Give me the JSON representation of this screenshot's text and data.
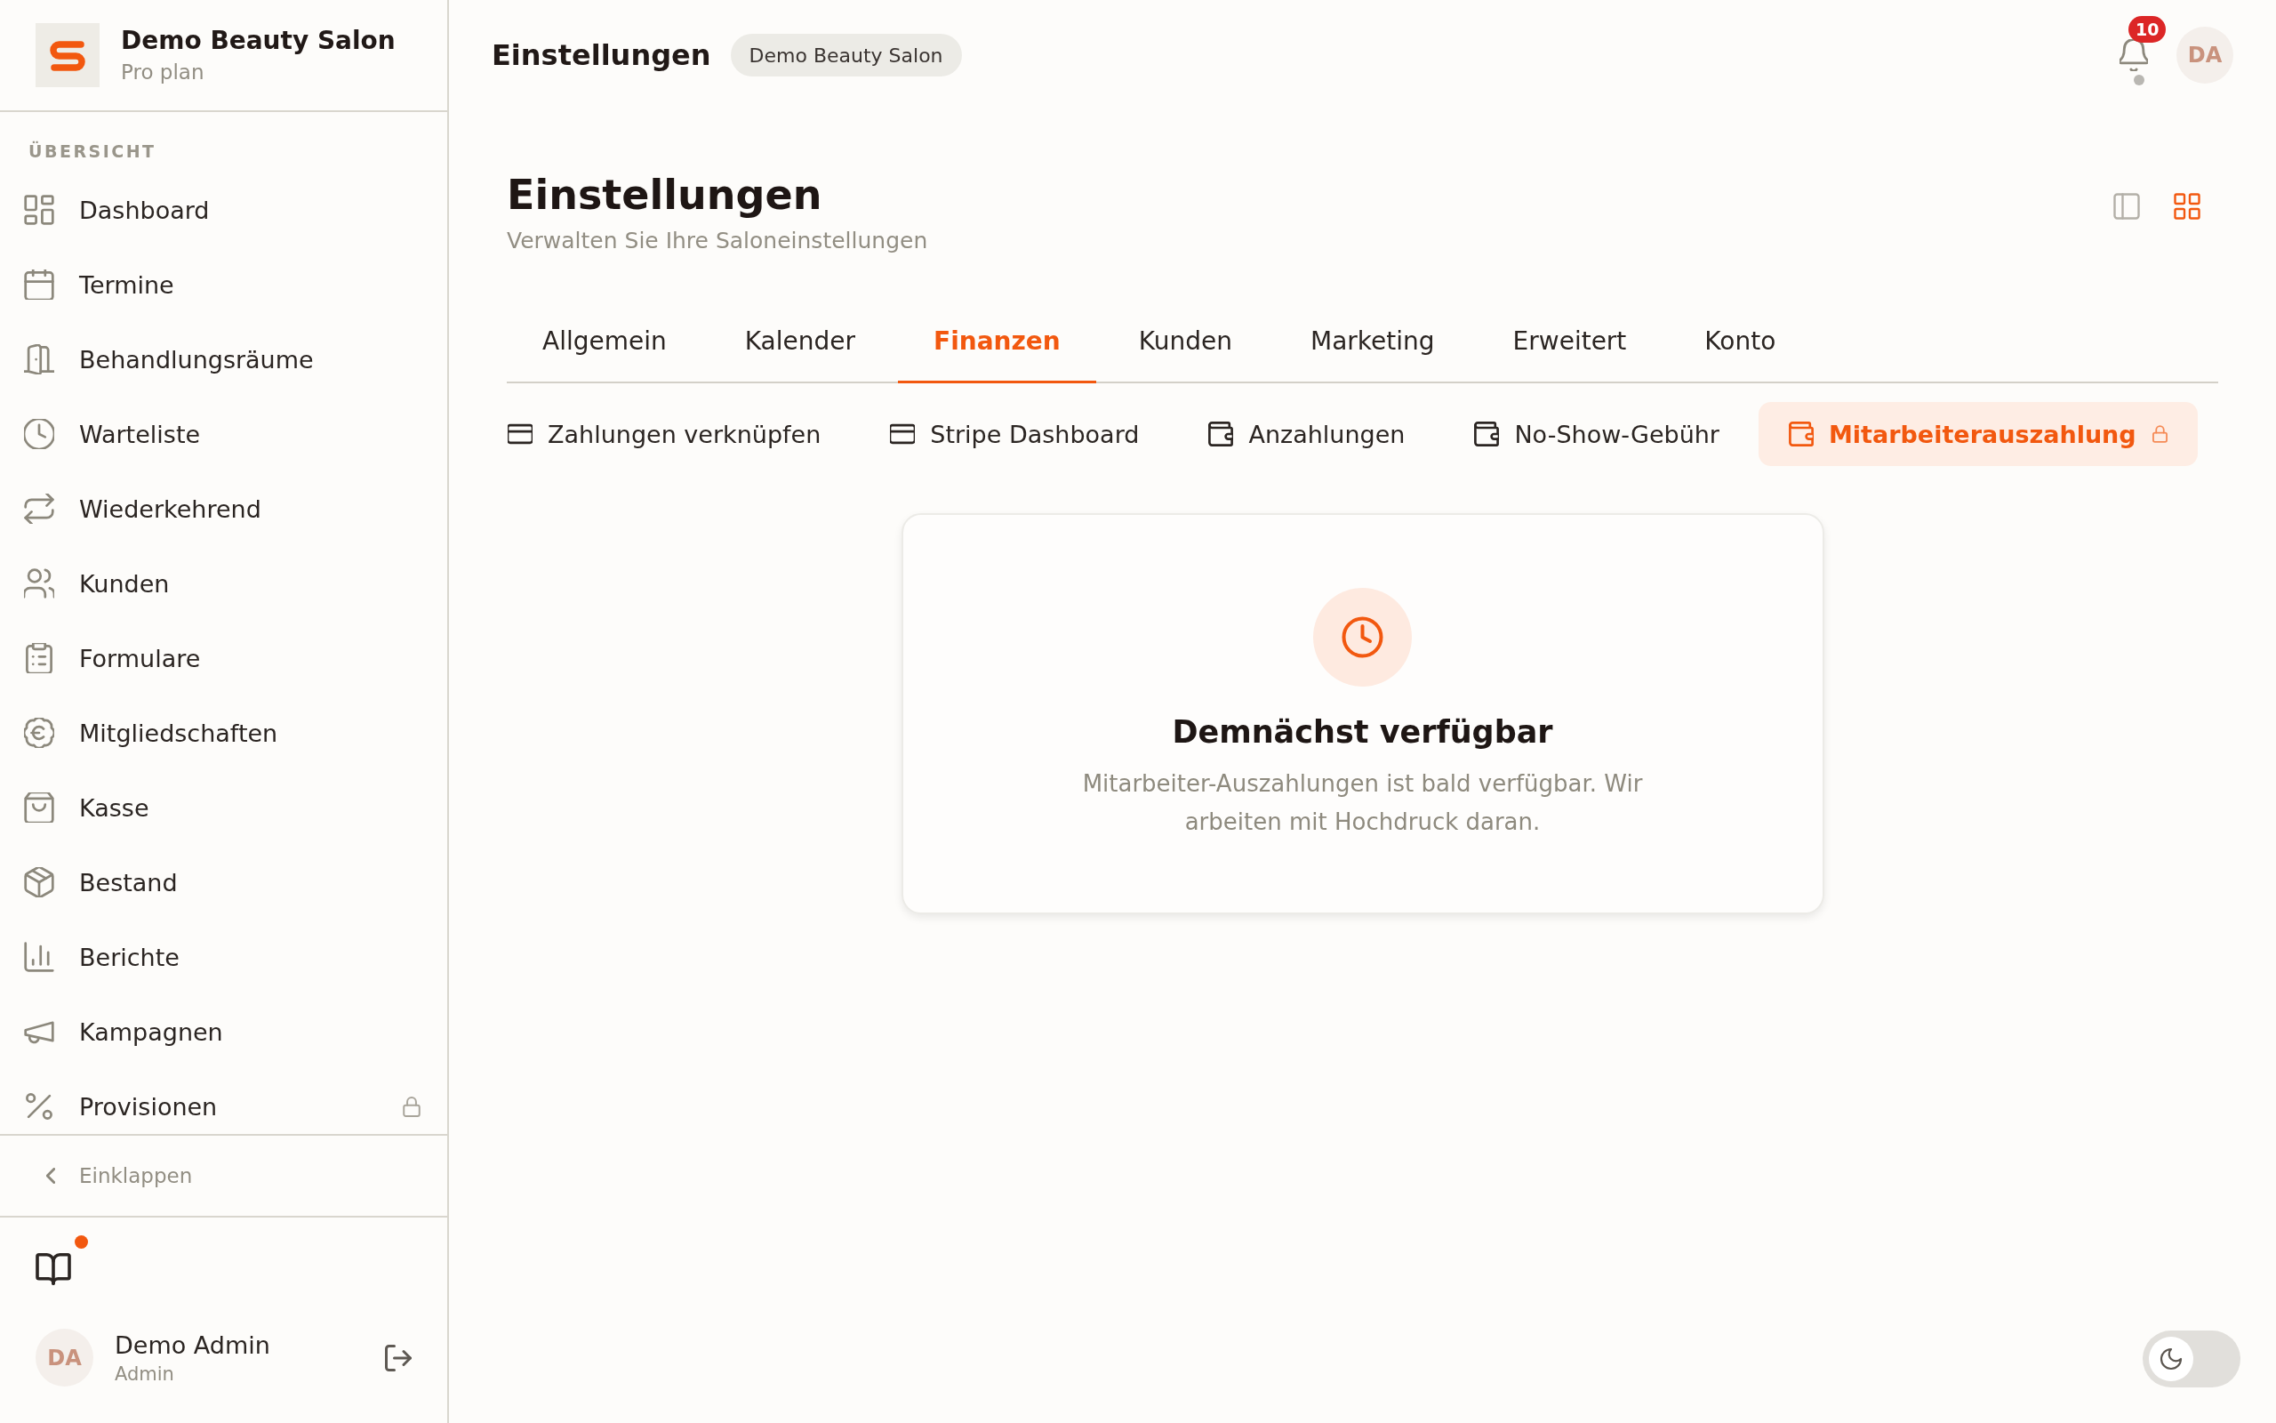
{
  "sidebar": {
    "brand": {
      "name": "Demo Beauty Salon",
      "plan": "Pro plan"
    },
    "section_label": "ÜBERSICHT",
    "items": [
      {
        "label": "Dashboard",
        "selected": false,
        "locked": false
      },
      {
        "label": "Termine",
        "selected": false,
        "locked": false
      },
      {
        "label": "Behandlungsräume",
        "selected": false,
        "locked": false
      },
      {
        "label": "Warteliste",
        "selected": false,
        "locked": false
      },
      {
        "label": "Wiederkehrend",
        "selected": false,
        "locked": false
      },
      {
        "label": "Kunden",
        "selected": false,
        "locked": false
      },
      {
        "label": "Formulare",
        "selected": false,
        "locked": false
      },
      {
        "label": "Mitgliedschaften",
        "selected": false,
        "locked": false
      },
      {
        "label": "Kasse",
        "selected": false,
        "locked": false
      },
      {
        "label": "Bestand",
        "selected": false,
        "locked": false
      },
      {
        "label": "Berichte",
        "selected": false,
        "locked": false
      },
      {
        "label": "Kampagnen",
        "selected": false,
        "locked": false
      },
      {
        "label": "Provisionen",
        "selected": false,
        "locked": true
      }
    ],
    "collapse_label": "Einklappen",
    "help": {
      "unread": true
    },
    "user": {
      "initials": "DA",
      "name": "Demo Admin",
      "role": "Admin"
    }
  },
  "topbar": {
    "title": "Einstellungen",
    "salon": "Demo Beauty Salon",
    "notification_count": "10",
    "user_initials": "DA"
  },
  "page": {
    "title": "Einstellungen",
    "subtitle": "Verwalten Sie Ihre Saloneinstellungen",
    "view_modes": [
      {
        "selected": false
      },
      {
        "selected": true
      }
    ]
  },
  "tabs": [
    {
      "label": "Allgemein",
      "selected": false
    },
    {
      "label": "Kalender",
      "selected": false
    },
    {
      "label": "Finanzen",
      "selected": true
    },
    {
      "label": "Kunden",
      "selected": false
    },
    {
      "label": "Marketing",
      "selected": false
    },
    {
      "label": "Erweitert",
      "selected": false
    },
    {
      "label": "Konto",
      "selected": false
    }
  ],
  "subtabs": [
    {
      "label": "Zahlungen verknüpfen",
      "selected": false,
      "locked": false
    },
    {
      "label": "Stripe Dashboard",
      "selected": false,
      "locked": false
    },
    {
      "label": "Anzahlungen",
      "selected": false,
      "locked": false
    },
    {
      "label": "No-Show-Gebühr",
      "selected": false,
      "locked": false
    },
    {
      "label": "Mitarbeiterauszahlung",
      "selected": true,
      "locked": true
    }
  ],
  "notice": {
    "title": "Demnächst verfügbar",
    "text": "Mitarbeiter-Auszahlungen ist bald verfügbar. Wir arbeiten mit Hochdruck daran."
  },
  "dark_mode": {
    "on": false
  }
}
